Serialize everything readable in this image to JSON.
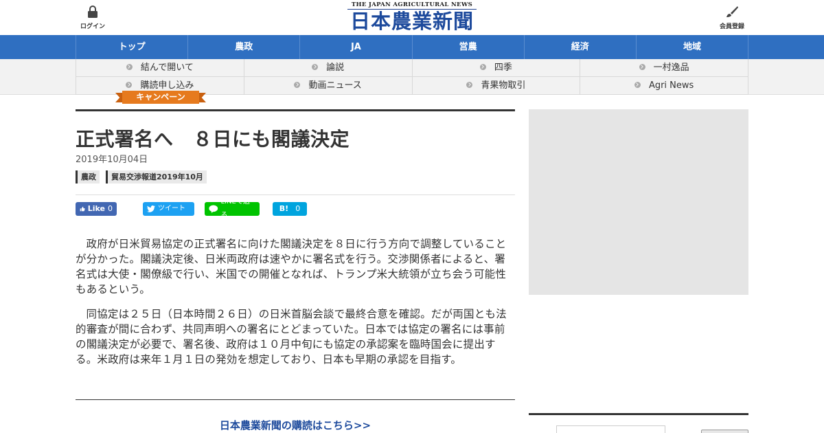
{
  "header": {
    "login_label": "ログイン",
    "register_label": "会員登録",
    "logo_en": "THE JAPAN AGRICULTURAL NEWS",
    "logo_jp": "日本農業新聞",
    "brand_color": "#1d4a9c",
    "nav_color": "#2f6fc1"
  },
  "main_nav": [
    "トップ",
    "農政",
    "JA",
    "営農",
    "経済",
    "地域"
  ],
  "sub_nav": {
    "row1": [
      "結んで開いて",
      "論説",
      "四季",
      "一村逸品"
    ],
    "row2": [
      "購読申し込み",
      "動画ニュース",
      "青果物取引",
      "Agri News"
    ]
  },
  "campaign_label": "キャンペーン",
  "article": {
    "title": "正式署名へ　８日にも閣議決定",
    "date": "2019年10月04日",
    "tags": [
      "農政",
      "貿易交渉報道2019年10月"
    ],
    "share": {
      "facebook_label": "Like",
      "facebook_count": "0",
      "twitter_label": "ツイート",
      "line_label": "LINEで送る",
      "hatena_label": "B!",
      "hatena_count": "0"
    },
    "paragraphs": [
      "政府が日米貿易協定の正式署名に向けた閣議決定を８日に行う方向で調整していることが分かった。閣議決定後、日米両政府は速やかに署名式を行う。交渉関係者によると、署名式は大使・閣僚級で行い、米国での開催となれば、トランプ米大統領が立ち会う可能性もあるという。",
      "同協定は２５日（日本時間２６日）の日米首脳会談で最終合意を確認。だが両国とも法的審査が間に合わず、共同声明への署名にとどまっていた。日本では協定の署名には事前の閣議決定が必要で、署名後、政府は１０月中旬にも協定の承認案を臨時国会に提出する。米政府は来年１月１日の発効を想定しており、日本も早期の承認を目指す。"
    ],
    "subscribe_link": "日本農業新聞の購読はこちら>>"
  }
}
